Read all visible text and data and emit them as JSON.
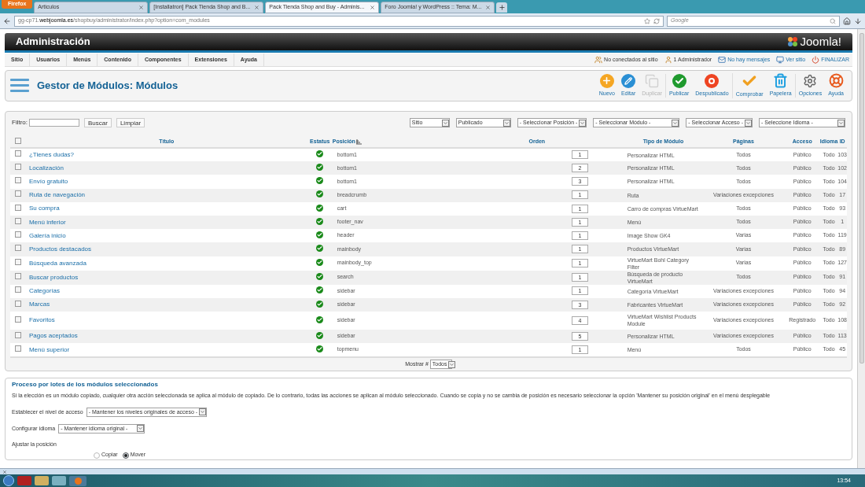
{
  "browser": {
    "menu_button": "Firefox",
    "tabs": [
      {
        "title": "Articulos",
        "selected": false
      },
      {
        "title": "[Installatron] Pack Tienda Shop and B...",
        "selected": false
      },
      {
        "title": "Pack Tienda Shop and Buy - Adminis...",
        "selected": true
      },
      {
        "title": "Foro Joomla! y WordPress :: Tema: M...",
        "selected": false
      }
    ],
    "address_prefix": "gg-cp71.",
    "address_domain": "webjoomla.es",
    "address_path": "/shopbuy/administrator/index.php?option=com_modules",
    "search_placeholder": "Google"
  },
  "header": {
    "title": "Administración",
    "logo": "Joomla!"
  },
  "menu": {
    "items": [
      "Sitio",
      "Usuarios",
      "Menús",
      "Contenido",
      "Componentes",
      "Extensiones",
      "Ayuda"
    ],
    "status": [
      {
        "kind": "users",
        "label": "No conectados al sitio"
      },
      {
        "kind": "admin",
        "label": "1 Administrador"
      },
      {
        "kind": "mail",
        "label": "No hay mensajes"
      },
      {
        "kind": "site",
        "label": "Ver sitio"
      },
      {
        "kind": "logout",
        "label": "FINALIZAR"
      }
    ]
  },
  "page_title": "Gestor de Módulos: Módulos",
  "toolbar": [
    {
      "kind": "new",
      "label": "Nuevo",
      "disabled": false
    },
    {
      "kind": "edit",
      "label": "Editar",
      "disabled": false
    },
    {
      "kind": "copy",
      "label": "Duplicar",
      "disabled": true
    },
    {
      "kind": "publish",
      "label": "Publicar",
      "disabled": false
    },
    {
      "kind": "unpublish",
      "label": "Despublicado",
      "disabled": false
    },
    {
      "kind": "check",
      "label": "Comprobar",
      "disabled": false
    },
    {
      "kind": "trash",
      "label": "Papelera",
      "disabled": false
    },
    {
      "kind": "options",
      "label": "Opciones",
      "disabled": false
    },
    {
      "kind": "help",
      "label": "Ayuda",
      "disabled": false
    }
  ],
  "filter": {
    "label": "Filtro:",
    "buttons": [
      "Buscar",
      "Limpiar"
    ],
    "selects": [
      "Sitio",
      "Publicado",
      "- Seleccionar Posición -",
      "- Seleccionar Módulo -",
      "- Seleccionar Acceso -",
      "- Seleccione Idioma -"
    ]
  },
  "table": {
    "select_all_checked": false,
    "columns": [
      "Título",
      "Estatus",
      "Posición",
      "Orden",
      "Tipo de Módulo",
      "Páginas",
      "Acceso",
      "Idioma",
      "ID"
    ],
    "rows": [
      {
        "checked": false,
        "title": "¿Tienes dudas?",
        "published": true,
        "position": "bottom1",
        "order": "1",
        "type": "Personalizar HTML",
        "pages": "Todos",
        "access": "Público",
        "language": "Todo",
        "id": "103"
      },
      {
        "checked": false,
        "title": "Localización",
        "published": true,
        "position": "bottom1",
        "order": "2",
        "type": "Personalizar HTML",
        "pages": "Todos",
        "access": "Público",
        "language": "Todo",
        "id": "102"
      },
      {
        "checked": false,
        "title": "Envío gratuito",
        "published": true,
        "position": "bottom1",
        "order": "3",
        "type": "Personalizar HTML",
        "pages": "Todos",
        "access": "Público",
        "language": "Todo",
        "id": "104"
      },
      {
        "checked": false,
        "title": "Ruta de navegación",
        "published": true,
        "position": "breadcrumb",
        "order": "1",
        "type": "Ruta",
        "pages": "Variaciones excepciones",
        "access": "Público",
        "language": "Todo",
        "id": "17"
      },
      {
        "checked": false,
        "title": "Su compra",
        "published": true,
        "position": "cart",
        "order": "1",
        "type": "Carro de compras VirtueMart",
        "pages": "Todos",
        "access": "Público",
        "language": "Todo",
        "id": "93"
      },
      {
        "checked": false,
        "title": "Menú inferior",
        "published": true,
        "position": "footer_nav",
        "order": "1",
        "type": "Menú",
        "pages": "Todos",
        "access": "Público",
        "language": "Todo",
        "id": "1"
      },
      {
        "checked": false,
        "title": "Galería inicio",
        "published": true,
        "position": "header",
        "order": "1",
        "type": "Image Show GK4",
        "pages": "Varias",
        "access": "Público",
        "language": "Todo",
        "id": "119"
      },
      {
        "checked": false,
        "title": "Productos destacados",
        "published": true,
        "position": "mainbody",
        "order": "1",
        "type": "Productos VirtueMart",
        "pages": "Varias",
        "access": "Público",
        "language": "Todo",
        "id": "89"
      },
      {
        "checked": false,
        "title": "Búsqueda avanzada",
        "published": true,
        "position": "mainbody_top",
        "order": "1",
        "type": "VirtueMart Bohl Category Filter",
        "pages": "Varias",
        "access": "Público",
        "language": "Todo",
        "id": "127"
      },
      {
        "checked": false,
        "title": "Buscar productos",
        "published": true,
        "position": "search",
        "order": "1",
        "type": "Búsqueda de producto VirtueMart",
        "pages": "Todos",
        "access": "Público",
        "language": "Todo",
        "id": "91"
      },
      {
        "checked": false,
        "title": "Categorías",
        "published": true,
        "position": "sidebar",
        "order": "1",
        "type": "Categoría VirtueMart",
        "pages": "Variaciones excepciones",
        "access": "Público",
        "language": "Todo",
        "id": "94"
      },
      {
        "checked": false,
        "title": "Marcas",
        "published": true,
        "position": "sidebar",
        "order": "3",
        "type": "Fabricantes VirtueMart",
        "pages": "Variaciones excepciones",
        "access": "Público",
        "language": "Todo",
        "id": "92"
      },
      {
        "checked": false,
        "title": "Favoritos",
        "published": true,
        "position": "sidebar",
        "order": "4",
        "type": "VirtueMart Wishlist Products Module",
        "pages": "Variaciones excepciones",
        "access": "Registrado",
        "language": "Todo",
        "id": "108"
      },
      {
        "checked": false,
        "title": "Pagos aceptados",
        "published": true,
        "position": "sidebar",
        "order": "5",
        "type": "Personalizar HTML",
        "pages": "Variaciones excepciones",
        "access": "Público",
        "language": "Todo",
        "id": "113"
      },
      {
        "checked": false,
        "title": "Menú superior",
        "published": true,
        "position": "topmenu",
        "order": "1",
        "type": "Menú",
        "pages": "Todos",
        "access": "Público",
        "language": "Todo",
        "id": "45"
      }
    ]
  },
  "pagination": {
    "label": "Mostrar #",
    "value": "Todos"
  },
  "batch": {
    "title": "Proceso por lotes de los módulos seleccionados",
    "description": "Si la elección es un módulo copiado, cualquier otra acción seleccionada se aplica al módulo de copiado. De lo contrario, todas las acciones se aplican al módulo seleccionado. Cuando se copia y no se cambia de posición es necesario seleccionar la opción 'Mantener su posición original' en el menú desplegable",
    "fields": [
      {
        "label": "Establecer el nivel de acceso",
        "value": "- Mantener los niveles originales de acceso -"
      },
      {
        "label": "Configurar idioma",
        "value": "- Mantener idioma original -"
      }
    ],
    "position_label": "Ajustar la posición",
    "radios": [
      {
        "label": "Copiar",
        "selected": false
      },
      {
        "label": "Mover",
        "selected": true
      }
    ]
  },
  "taskbar": {
    "clock": "13:54"
  }
}
